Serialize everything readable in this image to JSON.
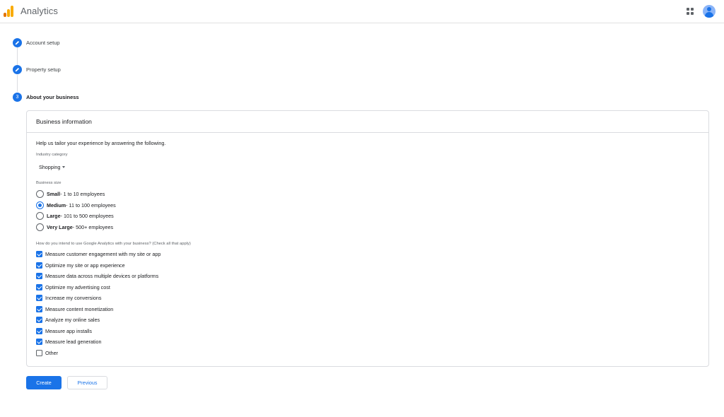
{
  "header": {
    "app_title": "Analytics"
  },
  "stepper": {
    "steps": [
      {
        "label": "Account setup",
        "state": "completed",
        "icon": "pencil-icon"
      },
      {
        "label": "Property setup",
        "state": "completed",
        "icon": "pencil-icon"
      },
      {
        "label": "About your business",
        "state": "active",
        "number": "3"
      }
    ]
  },
  "card": {
    "title": "Business information",
    "intro": "Help us tailor your experience by answering the following.",
    "industry": {
      "label": "Industry category",
      "selected": "Shopping"
    },
    "business_size": {
      "label": "Business size",
      "options": [
        {
          "name": "Small",
          "detail": " - 1 to 10 employees",
          "checked": false
        },
        {
          "name": "Medium",
          "detail": " - 11 to 100 employees",
          "checked": true
        },
        {
          "name": "Large",
          "detail": " - 101 to 500 employees",
          "checked": false
        },
        {
          "name": "Very Large",
          "detail": " - 500+ employees",
          "checked": false
        }
      ]
    },
    "usage": {
      "label": "How do you intend to use Google Analytics with your business? (Check all that apply)",
      "options": [
        {
          "label": "Measure customer engagement with my site or app",
          "checked": true
        },
        {
          "label": "Optimize my site or app experience",
          "checked": true
        },
        {
          "label": "Measure data across multiple devices or platforms",
          "checked": true
        },
        {
          "label": "Optimize my advertising cost",
          "checked": true
        },
        {
          "label": "Increase my conversions",
          "checked": true
        },
        {
          "label": "Measure content monetization",
          "checked": true
        },
        {
          "label": "Analyze my online sales",
          "checked": true
        },
        {
          "label": "Measure app installs",
          "checked": true
        },
        {
          "label": "Measure lead generation",
          "checked": true
        },
        {
          "label": "Other",
          "checked": false
        }
      ]
    }
  },
  "actions": {
    "create_label": "Create",
    "previous_label": "Previous"
  },
  "colors": {
    "accent": "#1a73e8",
    "logo_orange": "#e37400",
    "logo_yellow": "#f9ab00"
  }
}
